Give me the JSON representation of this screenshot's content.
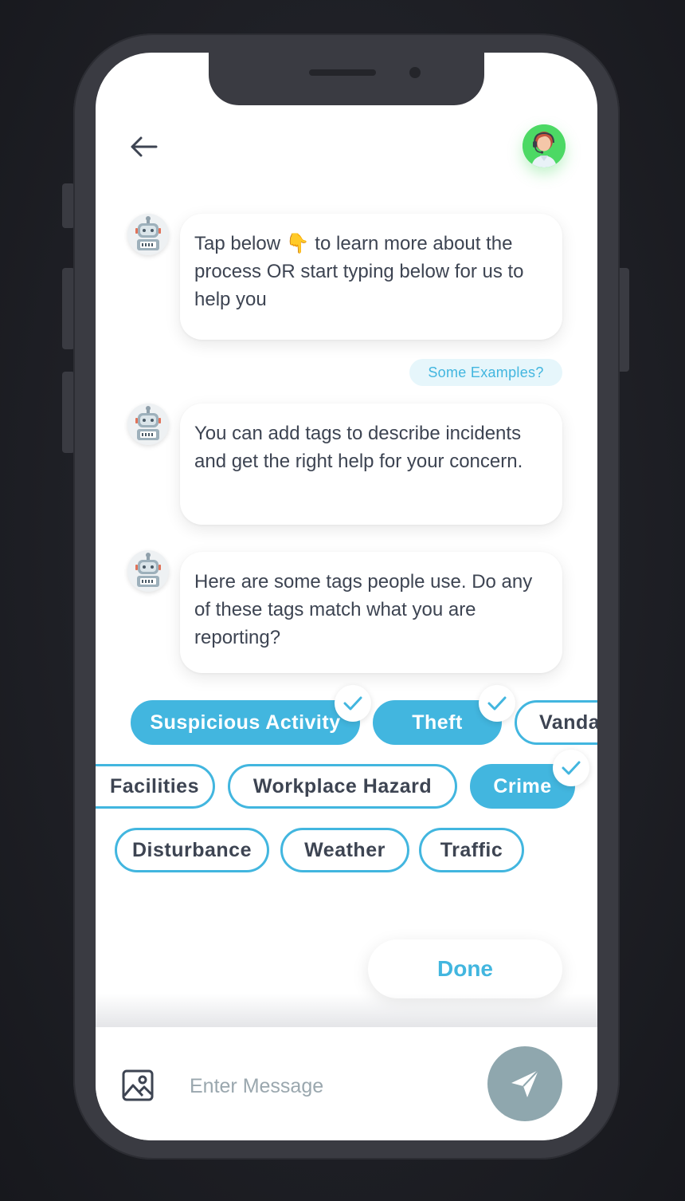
{
  "colors": {
    "accent": "#42b6df",
    "agent_avatar_bg": "#4cd964",
    "send_button": "#8fa7ae",
    "text": "#3d4452"
  },
  "header": {
    "back_icon": "arrow-left-icon",
    "agent_avatar": "support-agent-avatar"
  },
  "messages": [
    {
      "sender": "bot",
      "text_before": "Tap below ",
      "emoji": "👇",
      "text_after": " to learn more about the process OR start typing below for us to help you"
    },
    {
      "sender": "bot",
      "text": "You can add tags to describe incidents and get the right help for your concern."
    },
    {
      "sender": "bot",
      "text": "Here are some tags people use. Do any of these tags match what you are reporting?"
    }
  ],
  "examples_link": "Some Examples?",
  "tags": [
    {
      "label": "Suspicious Activity",
      "selected": true
    },
    {
      "label": "Theft",
      "selected": true
    },
    {
      "label": "Vanda",
      "selected": false
    },
    {
      "label": "Facilities",
      "selected": false
    },
    {
      "label": "Workplace Hazard",
      "selected": false
    },
    {
      "label": "Crime",
      "selected": true
    },
    {
      "label": "Disturbance",
      "selected": false
    },
    {
      "label": "Weather",
      "selected": false
    },
    {
      "label": "Traffic",
      "selected": false
    }
  ],
  "done_label": "Done",
  "composer": {
    "placeholder": "Enter Message",
    "image_icon": "image-icon",
    "send_icon": "paper-plane-icon"
  }
}
